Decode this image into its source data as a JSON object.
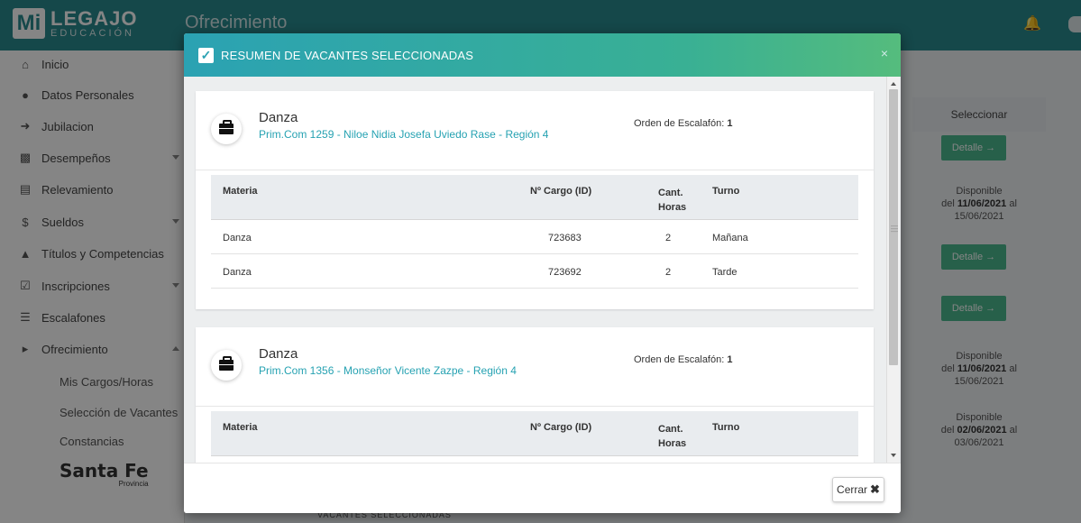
{
  "app": {
    "logo_mi": "Mi",
    "logo_name": "LEGAJO",
    "logo_sub": "EDUCACIÓN",
    "page_title": "Ofrecimiento",
    "brand_name": "Santa Fe",
    "brand_sub": "Provincia"
  },
  "sidebar": {
    "items": [
      {
        "label": "Inicio"
      },
      {
        "label": "Datos Personales"
      },
      {
        "label": "Jubilacion"
      },
      {
        "label": "Desempeños"
      },
      {
        "label": "Relevamiento"
      },
      {
        "label": "Sueldos"
      },
      {
        "label": "Títulos y Competencias"
      },
      {
        "label": "Inscripciones"
      },
      {
        "label": "Escalafones"
      },
      {
        "label": "Ofrecimiento"
      }
    ],
    "subitems": [
      {
        "label": "Mis Cargos/Horas"
      },
      {
        "label": "Selección de Vacantes"
      },
      {
        "label": "Constancias"
      }
    ]
  },
  "background_table": {
    "header": "Seleccionar",
    "button_label": "Detalle →",
    "disp": [
      {
        "line1": "Disponible",
        "line2a": "del ",
        "date1": "11/06/2021",
        "line2b": " al",
        "date2": "15/06/2021"
      },
      {
        "line1": "Disponible",
        "line2a": "del ",
        "date1": "11/06/2021",
        "line2b": " al",
        "date2": "15/06/2021"
      },
      {
        "line1": "Disponible",
        "line2a": "del ",
        "date1": "02/06/2021",
        "line2b": " al",
        "date2": "03/06/2021"
      }
    ],
    "footer_text": "VACANTES SELECCIONADAS"
  },
  "modal": {
    "title": "RESUMEN DE VACANTES SELECCIONADAS",
    "close_symbol": "×",
    "orden_label": "Orden de Escalafón: ",
    "columns": {
      "materia": "Materia",
      "cargo": "Nº Cargo (ID)",
      "cant_line1": "Cant.",
      "cant_line2": "Horas",
      "turno": "Turno"
    },
    "cards": [
      {
        "title": "Danza",
        "subtitle": "Prim.Com 1259 - Niloe Nidia Josefa Uviedo Rase - Región 4",
        "orden": "1",
        "rows": [
          {
            "materia": "Danza",
            "cargo": "723683",
            "cant": "2",
            "turno": "Mañana"
          },
          {
            "materia": "Danza",
            "cargo": "723692",
            "cant": "2",
            "turno": "Tarde"
          }
        ]
      },
      {
        "title": "Danza",
        "subtitle": "Prim.Com 1356 - Monseñor Vicente Zazpe - Región 4",
        "orden": "1",
        "rows": []
      }
    ],
    "footer_button": "Cerrar",
    "footer_button_icon": "✖"
  }
}
